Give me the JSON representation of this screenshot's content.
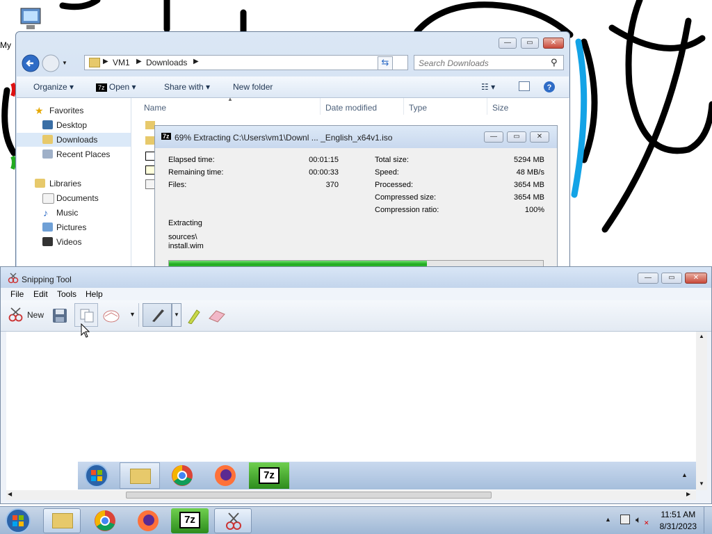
{
  "desktop": {
    "icon_label": "My"
  },
  "explorer": {
    "breadcrumb": [
      "VM1",
      "Downloads"
    ],
    "search_placeholder": "Search Downloads",
    "commands": {
      "organize": "Organize",
      "open": "Open",
      "share_with": "Share with",
      "new_folder": "New folder"
    },
    "nav": {
      "favorites": "Favorites",
      "favorites_items": [
        "Desktop",
        "Downloads",
        "Recent Places"
      ],
      "libraries": "Libraries",
      "libraries_items": [
        "Documents",
        "Music",
        "Pictures",
        "Videos"
      ],
      "selected": "Downloads"
    },
    "columns": [
      "Name",
      "Date modified",
      "Type",
      "Size"
    ]
  },
  "zip_dialog": {
    "title": "69% Extracting C:\\Users\\vm1\\Downl ... _English_x64v1.iso",
    "logo_text": "7z",
    "left_stats": [
      {
        "label": "Elapsed time:",
        "value": "00:01:15"
      },
      {
        "label": "Remaining time:",
        "value": "00:00:33"
      },
      {
        "label": "Files:",
        "value": "370"
      }
    ],
    "right_stats": [
      {
        "label": "Total size:",
        "value": "5294 MB"
      },
      {
        "label": "Speed:",
        "value": "48 MB/s"
      },
      {
        "label": "Processed:",
        "value": "3654 MB"
      },
      {
        "label": "Compressed size:",
        "value": "3654 MB"
      },
      {
        "label": "Compression ratio:",
        "value": "100%"
      }
    ],
    "status_label": "Extracting",
    "current_path": "sources\\",
    "current_file": "install.wim",
    "progress_fraction": 0.69
  },
  "snipping_tool": {
    "title": "Snipping Tool",
    "menus": [
      "File",
      "Edit",
      "Tools",
      "Help"
    ],
    "new_label": "New"
  },
  "taskbar": {
    "time": "11:51 AM",
    "date": "8/31/2023",
    "zip_label": "7z"
  },
  "colors": {
    "accent": "#1fa91f",
    "aero_blue": "#c5d6ec",
    "close_red": "#c9493a"
  }
}
